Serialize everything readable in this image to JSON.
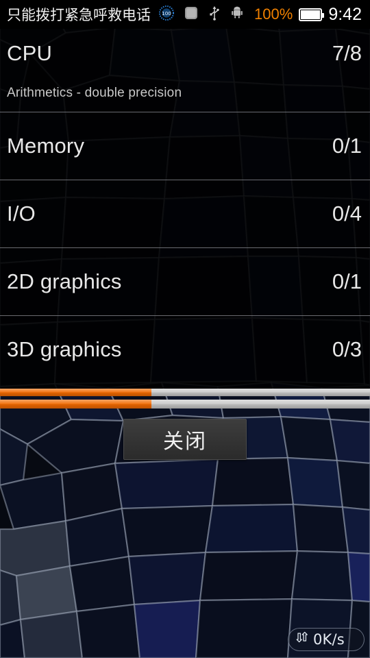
{
  "status_bar": {
    "carrier_text": "只能拨打紧急呼救电话",
    "icons": [
      {
        "name": "battery-100-badge-icon",
        "label": "100"
      },
      {
        "name": "screenshot-icon",
        "label": ""
      },
      {
        "name": "usb-icon",
        "label": ""
      },
      {
        "name": "android-debug-icon",
        "label": ""
      }
    ],
    "battery_percent": "100%",
    "battery_icon": "battery-full-icon",
    "clock": "9:42"
  },
  "benchmark": {
    "rows": [
      {
        "label": "CPU",
        "count": "7/8",
        "sublabel": "Arithmetics - double precision"
      },
      {
        "label": "Memory",
        "count": "0/1",
        "sublabel": ""
      },
      {
        "label": "I/O",
        "count": "0/4",
        "sublabel": ""
      },
      {
        "label": "2D graphics",
        "count": "0/1",
        "sublabel": ""
      },
      {
        "label": "3D graphics",
        "count": "0/3",
        "sublabel": ""
      }
    ],
    "progress": {
      "top_percent": 41,
      "bottom_percent": 41,
      "fill_color": "#f26a00",
      "track_color": "#c9c9c9"
    },
    "close_button_label": "关闭"
  },
  "net_speed": {
    "label": "0K/s",
    "icon": "upload-download-arrows-icon"
  },
  "theme": {
    "accent": "#f26a00",
    "battery_text": "#f08000",
    "text_primary": "#e8e8e8",
    "background": "#05070d"
  }
}
